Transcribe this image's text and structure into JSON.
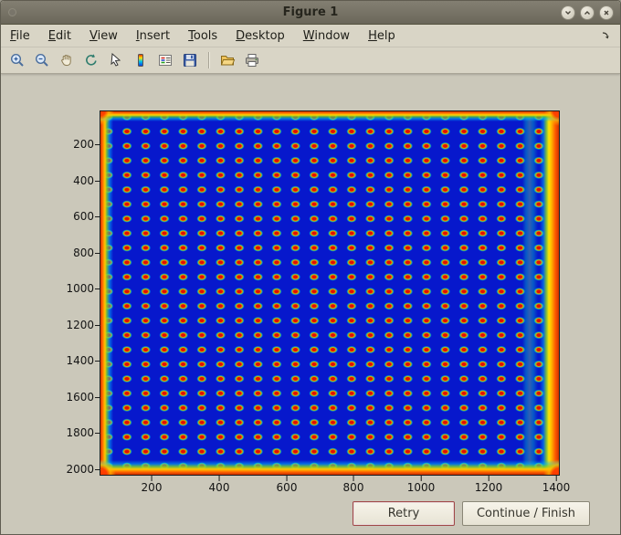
{
  "window": {
    "title": "Figure 1",
    "controls": [
      "minimize",
      "maximize",
      "close"
    ]
  },
  "menubar": {
    "items": [
      {
        "label": "File"
      },
      {
        "label": "Edit"
      },
      {
        "label": "View"
      },
      {
        "label": "Insert"
      },
      {
        "label": "Tools"
      },
      {
        "label": "Desktop"
      },
      {
        "label": "Window"
      },
      {
        "label": "Help"
      }
    ]
  },
  "toolbar": {
    "icons": [
      "zoom-in",
      "zoom-out",
      "pan-hand",
      "rotate-3d",
      "data-cursor",
      "colorbar",
      "legend",
      "save",
      "open-folder",
      "print"
    ]
  },
  "plot": {
    "yticks": [
      "200",
      "400",
      "600",
      "800",
      "1000",
      "1200",
      "1400",
      "1600",
      "1800",
      "2000"
    ],
    "xticks": [
      "200",
      "400",
      "600",
      "800",
      "1000",
      "1200",
      "1400"
    ]
  },
  "actions": {
    "retry_label": "Retry",
    "continue_label": "Continue / Finish"
  },
  "colors": {
    "chrome": "#d9d5c6",
    "canvas": "#cbc8ba",
    "titlebar": "#6f6b5e",
    "heatmap_base": "#0718cc",
    "spot_core": "#e01000",
    "edge_hot": "#ff4b00",
    "retry_border": "#a04848"
  },
  "chart_data": {
    "type": "heatmap",
    "title": "",
    "xlabel": "",
    "ylabel": "",
    "x_ticks": [
      200,
      400,
      600,
      800,
      1000,
      1200,
      1400
    ],
    "y_ticks": [
      200,
      400,
      600,
      800,
      1000,
      1200,
      1400,
      1600,
      1800,
      2000
    ],
    "xlim": [
      1,
      1450
    ],
    "ylim": [
      1,
      2100
    ],
    "y_axis_direction": "reverse",
    "grid": {
      "rows": 24,
      "cols": 23
    },
    "colormap": "jet",
    "description": "Image plot of a plate/array scan: a regular grid of about 23 x 24 red-orange spots with yellow-green halos on a deep blue background; the image borders saturate to red and yellow (hot edge artifacts), strongest along the right and bottom edges and at the corners."
  }
}
